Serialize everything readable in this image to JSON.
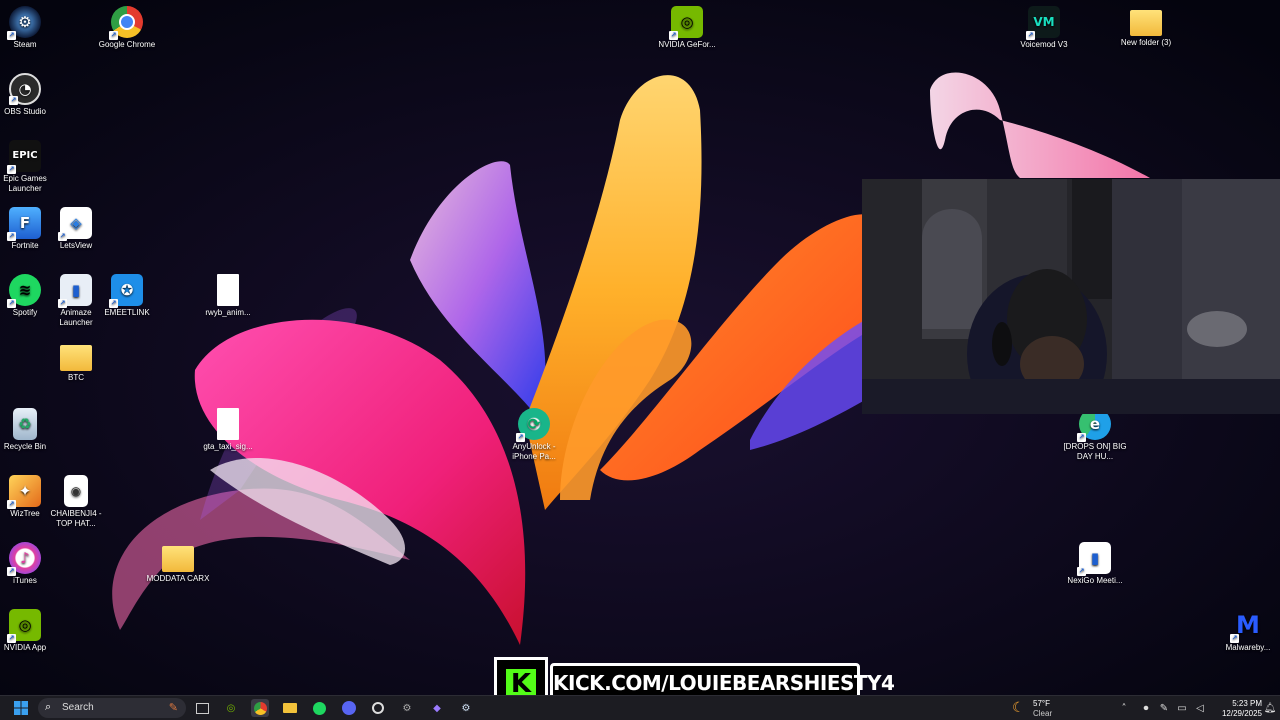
{
  "desktop": {
    "icons": [
      {
        "label": "Steam",
        "icon": "steam-icon"
      },
      {
        "label": "Google Chrome",
        "icon": "chrome-icon"
      },
      {
        "label": "OBS Studio",
        "icon": "obs-icon"
      },
      {
        "label": "Epic Games Launcher",
        "icon": "epic-games-icon",
        "glyph": "EPIC"
      },
      {
        "label": "Fortnite",
        "icon": "fortnite-icon",
        "glyph": "F"
      },
      {
        "label": "LetsView",
        "icon": "letsview-icon"
      },
      {
        "label": "Spotify",
        "icon": "spotify-icon"
      },
      {
        "label": "Animaze Launcher",
        "icon": "animaze-icon"
      },
      {
        "label": "EMEETLINK",
        "icon": "emeetlink-icon"
      },
      {
        "label": "rwyb_anim...",
        "icon": "file-icon"
      },
      {
        "label": "BTC",
        "icon": "folder-icon"
      },
      {
        "label": "Recycle Bin",
        "icon": "recycle-bin-icon"
      },
      {
        "label": "gta_taxi_sig...",
        "icon": "file-icon"
      },
      {
        "label": "AnyUnlock - iPhone Pa...",
        "icon": "anyunlock-icon"
      },
      {
        "label": "WizTree",
        "icon": "wiztree-icon"
      },
      {
        "label": "CHAIBENJI4 - TOP HAT...",
        "icon": "video-file-icon"
      },
      {
        "label": "iTunes",
        "icon": "itunes-icon"
      },
      {
        "label": "MODDATA CARX",
        "icon": "folder-icon"
      },
      {
        "label": "NVIDIA App",
        "icon": "nvidia-app-icon"
      },
      {
        "label": "NVIDIA GeFor...",
        "icon": "nvidia-geforce-icon"
      },
      {
        "label": "Voicemod V3",
        "icon": "voicemod-icon"
      },
      {
        "label": "New folder (3)",
        "icon": "folder-icon"
      },
      {
        "label": "[DROPS ON] BIG DAY HU...",
        "icon": "edge-icon"
      },
      {
        "label": "NexiGo Meeti...",
        "icon": "nexigo-icon"
      },
      {
        "label": "Malwareby...",
        "icon": "malwarebytes-icon",
        "glyph": "M"
      }
    ]
  },
  "overlay": {
    "kick_logo": "K",
    "banner_text": "KICK.COM/LOUIEBEARSHIESTY4"
  },
  "taskbar": {
    "search_placeholder": "Search",
    "weather_temp": "57°F",
    "weather_condition": "Clear",
    "time": "5:23 PM",
    "date": "12/29/2025"
  }
}
